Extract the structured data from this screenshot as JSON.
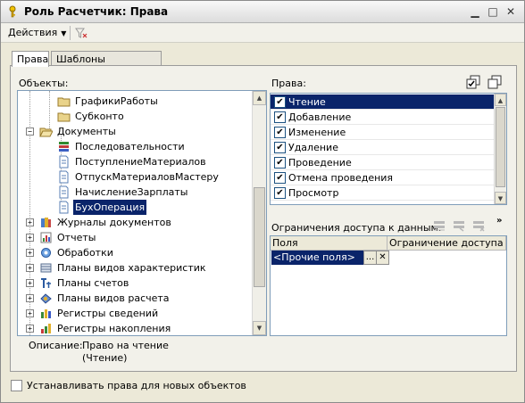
{
  "window": {
    "title": "Роль Расчетчик: Права"
  },
  "toolbar": {
    "actions_label": "Действия"
  },
  "tabs": [
    {
      "label": "Права",
      "active": true
    },
    {
      "label": "Шаблоны ограничений",
      "active": false
    }
  ],
  "objects": {
    "label": "Объекты:",
    "tree": [
      {
        "label": "ГрафикиРаботы",
        "icon": "folder-icon",
        "selected": false
      },
      {
        "label": "Субконто",
        "icon": "folder-icon",
        "selected": false
      },
      {
        "label": "Документы",
        "icon": "open-folder-icon",
        "selected": false,
        "expander": "−"
      },
      {
        "label": "Последовательности",
        "icon": "sequence-icon",
        "selected": false
      },
      {
        "label": "ПоступлениеМатериалов",
        "icon": "document-icon",
        "selected": false
      },
      {
        "label": "ОтпускМатериаловМастеру",
        "icon": "document-icon",
        "selected": false
      },
      {
        "label": "НачислениеЗарплаты",
        "icon": "document-icon",
        "selected": false
      },
      {
        "label": "БухОперация",
        "icon": "document-icon",
        "selected": true
      },
      {
        "label": "Журналы документов",
        "icon": "journal-icon",
        "selected": false,
        "expander": "+"
      },
      {
        "label": "Отчеты",
        "icon": "report-icon",
        "selected": false,
        "expander": "+"
      },
      {
        "label": "Обработки",
        "icon": "processing-icon",
        "selected": false,
        "expander": "+"
      },
      {
        "label": "Планы видов характеристик",
        "icon": "chart-types-icon",
        "selected": false,
        "expander": "+"
      },
      {
        "label": "Планы счетов",
        "icon": "accounts-icon",
        "selected": false,
        "expander": "+"
      },
      {
        "label": "Планы видов расчета",
        "icon": "calc-types-icon",
        "selected": false,
        "expander": "+"
      },
      {
        "label": "Регистры сведений",
        "icon": "info-register-icon",
        "selected": false,
        "expander": "+"
      },
      {
        "label": "Регистры накопления",
        "icon": "accum-register-icon",
        "selected": false,
        "expander": "+"
      }
    ]
  },
  "rights": {
    "label": "Права:",
    "items": [
      {
        "label": "Чтение",
        "checked": true,
        "selected": true
      },
      {
        "label": "Добавление",
        "checked": true,
        "selected": false
      },
      {
        "label": "Изменение",
        "checked": true,
        "selected": false
      },
      {
        "label": "Удаление",
        "checked": true,
        "selected": false
      },
      {
        "label": "Проведение",
        "checked": true,
        "selected": false
      },
      {
        "label": "Отмена проведения",
        "checked": true,
        "selected": false
      },
      {
        "label": "Просмотр",
        "checked": true,
        "selected": false
      }
    ]
  },
  "restrictions": {
    "label": "Ограничения доступа к данным:",
    "col_fields": "Поля",
    "col_restriction": "Ограничение доступа",
    "row_value": "<Прочие поля>",
    "select_btn": "...",
    "clear_btn": "✕"
  },
  "description": {
    "label": "Описание:",
    "line1": "Право на чтение",
    "line2": "(Чтение)"
  },
  "footer": {
    "checkbox_label": "Устанавливать права для новых объектов",
    "checked": false
  },
  "colors": {
    "selection": "#0a246a",
    "window_bg": "#ece9d8"
  }
}
